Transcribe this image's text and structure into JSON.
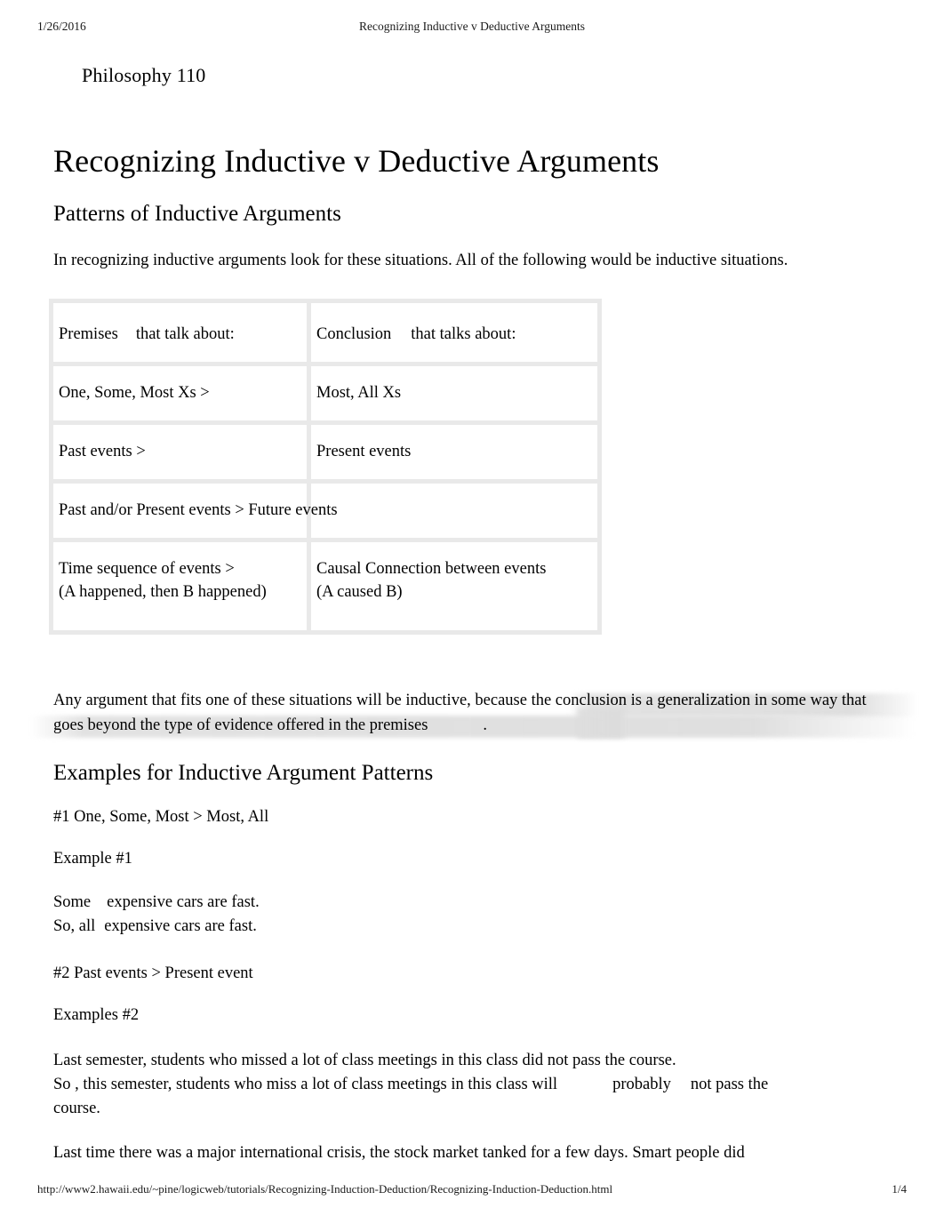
{
  "header": {
    "date": "1/26/2016",
    "title": "Recognizing Inductive v Deductive Arguments"
  },
  "footer": {
    "url": "http://www2.hawaii.edu/~pine/logicweb/tutorials/Recognizing-Induction-Deduction/Recognizing-Induction-Deduction.html",
    "page": "1/4"
  },
  "document": {
    "course": "Philosophy 110",
    "title": "Recognizing Inductive v Deductive Arguments",
    "section_1_heading": "Patterns of Inductive Arguments",
    "intro_paragraph": "In recognizing inductive arguments look for these situations. All of the following would be inductive situations.",
    "table": {
      "col1_header_a": "Premises",
      "col1_header_b": "that talk about:",
      "col2_header_a": "Conclusion",
      "col2_header_b": "that talks about:",
      "rows": [
        {
          "premise": "One, Some, Most Xs >",
          "conclusion": "Most, All Xs"
        },
        {
          "premise": "Past events >",
          "conclusion": "Present events"
        },
        {
          "premise": "Past and/or Present events > Future events",
          "conclusion": ""
        },
        {
          "premise_line1": "Time sequence of events >",
          "premise_line2": "(A happened, then B happened)",
          "conclusion_line1": "Causal Connection between events",
          "conclusion_line2": "(A caused B)"
        }
      ]
    },
    "after_table_paragraph_a": "Any argument that fits one of these situations will be inductive, because the conclusion is a generalization in",
    "after_table_paragraph_b": "some way that goes beyond the type of evidence offered in the premises",
    "after_table_paragraph_c": ".",
    "section_2_heading": "Examples for Inductive Argument Patterns",
    "pattern_1": "#1 One, Some, Most > Most, All",
    "example_1_label": "Example #1",
    "example_1_line1_a": "Some",
    "example_1_line1_b": "expensive cars are fast.",
    "example_1_line2_a": "So, all",
    "example_1_line2_b": "expensive cars are fast.",
    "pattern_2": "#2 Past events > Present event",
    "example_2_label": "Examples #2",
    "example_2_line1": "Last semester, students who missed a lot of class meetings in this class did not pass the course.",
    "example_2_line2_a": "So , this semester, students who miss a lot of class meetings in this class will",
    "example_2_line2_b": "probably",
    "example_2_line2_c": "not pass the",
    "example_2_line3": "course.",
    "example_2_trailing": "Last time there was a major international crisis, the stock market tanked for a few days. Smart people did"
  }
}
